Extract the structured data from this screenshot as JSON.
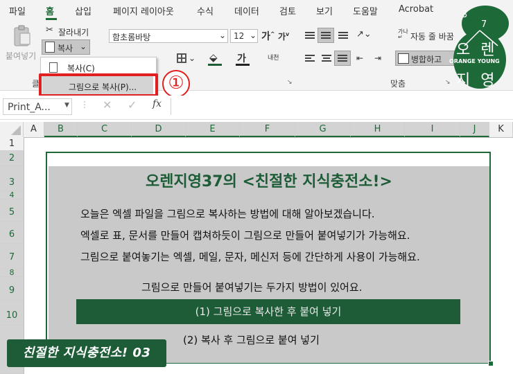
{
  "menu": {
    "items": [
      "파일",
      "홈",
      "삽입",
      "페이지 레이아웃",
      "수식",
      "데이터",
      "검토",
      "보기",
      "도움말",
      "Acrobat"
    ],
    "active": "홈"
  },
  "ribbon": {
    "paste_label": "붙여넣기",
    "cut_label": "잘라내기",
    "copy_label": "복사",
    "font_name": "함초롬바탕",
    "font_size": "12",
    "wrap_text_label": "자동 줄 바꿈",
    "merge_label": "병합하고",
    "group_clipboard": "클",
    "group_alignment": "맞춤"
  },
  "copy_menu": {
    "copy_item": "복사(C)",
    "copy_picture_item": "그림으로 복사(P)..."
  },
  "step_badge": "①",
  "formula_bar": {
    "name_box": "Print_A...",
    "fx_label": "fx"
  },
  "columns": [
    "A",
    "B",
    "C",
    "D",
    "E",
    "F",
    "G",
    "H",
    "I",
    "J",
    "K"
  ],
  "rows": [
    "1",
    "2",
    "3",
    "4",
    "5",
    "6",
    "7",
    "8",
    "9",
    "10"
  ],
  "content": {
    "title": "오렌지영37의 <친절한 지식충전소!>",
    "line1": "오늘은 엑셀 파일을 그림으로 복사하는 방법에 대해 알아보겠습니다.",
    "line2": "엑셀로 표, 문서를 만들어 캡쳐하듯이 그림으로 만들어 붙여넣기가 가능해요.",
    "line3": "그림으로 붙여놓기는 엑셀, 메일, 문자, 메신저 등에 간단하게 사용이 가능해요.",
    "line4": "그림으로 만들어 붙여넣기는 두가지 방법이 있어요.",
    "option1": "(1) 그림으로 복사한 후 붙여 넣기",
    "option2": "(2) 복사 후 그림으로 붙여 넣기"
  },
  "footer_badge": "친절한 지식충전소! 03",
  "logo": {
    "text_top": "오 렌",
    "text_bottom": "지 영",
    "tagline": "ORANGE YOUNG",
    "num1": "3",
    "num2": "7"
  },
  "colors": {
    "accent": "#1d5c36",
    "highlight_red": "#e02020",
    "panel_gray": "#c9c9c9"
  }
}
